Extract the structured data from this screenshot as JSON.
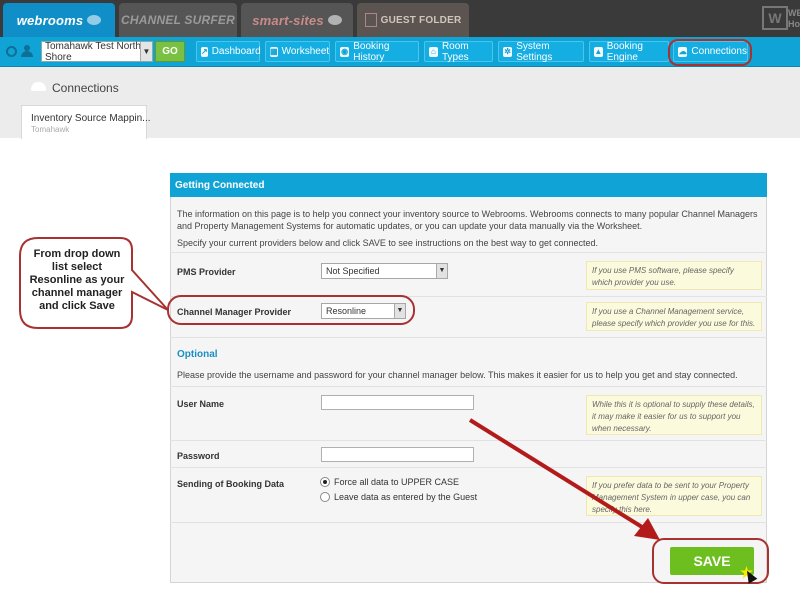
{
  "brands": {
    "webrooms": "webrooms",
    "channel_surfer": "CHANNEL SURFER",
    "smart_sites": "smart-sites",
    "guest_folder": "GUEST FOLDER",
    "corner_text": "WEL Hospi"
  },
  "nav": {
    "property_value": "Tomahawk Test North Shore",
    "go_label": "GO",
    "items": [
      {
        "label": "Dashboard",
        "icon": "chart-icon"
      },
      {
        "label": "Worksheet",
        "icon": "grid-icon"
      },
      {
        "label": "Booking History",
        "icon": "globe-icon"
      },
      {
        "label": "Room Types",
        "icon": "home-icon"
      },
      {
        "label": "System Settings",
        "icon": "gear-icon"
      },
      {
        "label": "Booking Engine",
        "icon": "building-icon"
      },
      {
        "label": "Connections",
        "icon": "cloud-icon"
      }
    ],
    "highlight_color": "#a83232",
    "accent_color": "#10a3d6"
  },
  "page": {
    "title": "Connections",
    "subtab_title": "Inventory Source Mappin...",
    "subtab_sub": "Tomahawk"
  },
  "panel": {
    "heading": "Getting Connected",
    "intro": "The information on this page is to help you connect your inventory source to Webrooms. Webrooms connects to many popular Channel Managers and Property Management Systems for automatic updates, or you can update your data manually via the Worksheet.",
    "intro2": "Specify your current providers below and click SAVE to see instructions on the best way to get connected.",
    "pms_label": "PMS Provider",
    "pms_value": "Not Specified",
    "pms_hint": "If you use PMS software, please specify which provider you use.",
    "cm_label": "Channel Manager Provider",
    "cm_value": "Resonline",
    "cm_hint": "If you use a Channel Management service, please specify which provider you use for this.",
    "optional_heading": "Optional",
    "optional_text": "Please provide the username and password for your channel manager below. This makes it easier for us to help you get and stay connected.",
    "username_label": "User Name",
    "username_hint": "While this it is optional to supply these details, it may make it easier for us to support you when necessary.",
    "password_label": "Password",
    "sending_label": "Sending of Booking Data",
    "radio_upper": "Force all data to UPPER CASE",
    "radio_leave": "Leave data as entered by the Guest",
    "sending_hint": "If you prefer data to be sent to your Property Management System in upper case, you can specify this here.",
    "save_label": "SAVE"
  },
  "callout": {
    "text": "From drop down list select Resonline as your channel manager and click Save"
  }
}
